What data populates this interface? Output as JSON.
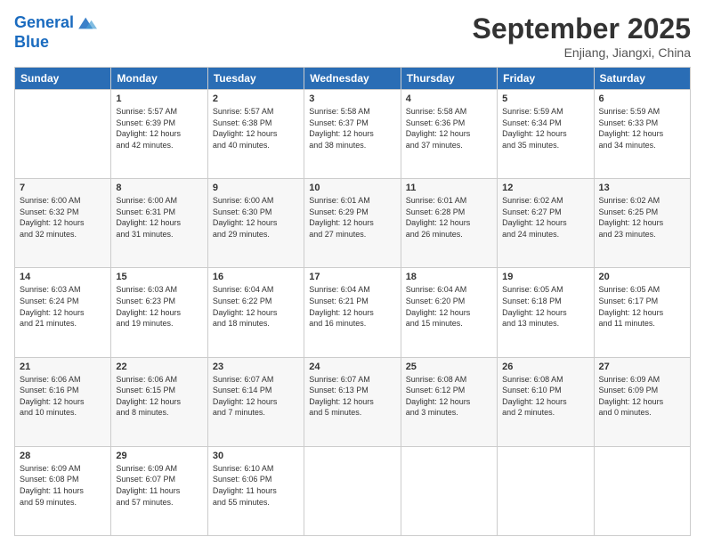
{
  "logo": {
    "line1": "General",
    "line2": "Blue"
  },
  "title": "September 2025",
  "location": "Enjiang, Jiangxi, China",
  "headers": [
    "Sunday",
    "Monday",
    "Tuesday",
    "Wednesday",
    "Thursday",
    "Friday",
    "Saturday"
  ],
  "weeks": [
    [
      {
        "day": "",
        "info": ""
      },
      {
        "day": "1",
        "info": "Sunrise: 5:57 AM\nSunset: 6:39 PM\nDaylight: 12 hours\nand 42 minutes."
      },
      {
        "day": "2",
        "info": "Sunrise: 5:57 AM\nSunset: 6:38 PM\nDaylight: 12 hours\nand 40 minutes."
      },
      {
        "day": "3",
        "info": "Sunrise: 5:58 AM\nSunset: 6:37 PM\nDaylight: 12 hours\nand 38 minutes."
      },
      {
        "day": "4",
        "info": "Sunrise: 5:58 AM\nSunset: 6:36 PM\nDaylight: 12 hours\nand 37 minutes."
      },
      {
        "day": "5",
        "info": "Sunrise: 5:59 AM\nSunset: 6:34 PM\nDaylight: 12 hours\nand 35 minutes."
      },
      {
        "day": "6",
        "info": "Sunrise: 5:59 AM\nSunset: 6:33 PM\nDaylight: 12 hours\nand 34 minutes."
      }
    ],
    [
      {
        "day": "7",
        "info": "Sunrise: 6:00 AM\nSunset: 6:32 PM\nDaylight: 12 hours\nand 32 minutes."
      },
      {
        "day": "8",
        "info": "Sunrise: 6:00 AM\nSunset: 6:31 PM\nDaylight: 12 hours\nand 31 minutes."
      },
      {
        "day": "9",
        "info": "Sunrise: 6:00 AM\nSunset: 6:30 PM\nDaylight: 12 hours\nand 29 minutes."
      },
      {
        "day": "10",
        "info": "Sunrise: 6:01 AM\nSunset: 6:29 PM\nDaylight: 12 hours\nand 27 minutes."
      },
      {
        "day": "11",
        "info": "Sunrise: 6:01 AM\nSunset: 6:28 PM\nDaylight: 12 hours\nand 26 minutes."
      },
      {
        "day": "12",
        "info": "Sunrise: 6:02 AM\nSunset: 6:27 PM\nDaylight: 12 hours\nand 24 minutes."
      },
      {
        "day": "13",
        "info": "Sunrise: 6:02 AM\nSunset: 6:25 PM\nDaylight: 12 hours\nand 23 minutes."
      }
    ],
    [
      {
        "day": "14",
        "info": "Sunrise: 6:03 AM\nSunset: 6:24 PM\nDaylight: 12 hours\nand 21 minutes."
      },
      {
        "day": "15",
        "info": "Sunrise: 6:03 AM\nSunset: 6:23 PM\nDaylight: 12 hours\nand 19 minutes."
      },
      {
        "day": "16",
        "info": "Sunrise: 6:04 AM\nSunset: 6:22 PM\nDaylight: 12 hours\nand 18 minutes."
      },
      {
        "day": "17",
        "info": "Sunrise: 6:04 AM\nSunset: 6:21 PM\nDaylight: 12 hours\nand 16 minutes."
      },
      {
        "day": "18",
        "info": "Sunrise: 6:04 AM\nSunset: 6:20 PM\nDaylight: 12 hours\nand 15 minutes."
      },
      {
        "day": "19",
        "info": "Sunrise: 6:05 AM\nSunset: 6:18 PM\nDaylight: 12 hours\nand 13 minutes."
      },
      {
        "day": "20",
        "info": "Sunrise: 6:05 AM\nSunset: 6:17 PM\nDaylight: 12 hours\nand 11 minutes."
      }
    ],
    [
      {
        "day": "21",
        "info": "Sunrise: 6:06 AM\nSunset: 6:16 PM\nDaylight: 12 hours\nand 10 minutes."
      },
      {
        "day": "22",
        "info": "Sunrise: 6:06 AM\nSunset: 6:15 PM\nDaylight: 12 hours\nand 8 minutes."
      },
      {
        "day": "23",
        "info": "Sunrise: 6:07 AM\nSunset: 6:14 PM\nDaylight: 12 hours\nand 7 minutes."
      },
      {
        "day": "24",
        "info": "Sunrise: 6:07 AM\nSunset: 6:13 PM\nDaylight: 12 hours\nand 5 minutes."
      },
      {
        "day": "25",
        "info": "Sunrise: 6:08 AM\nSunset: 6:12 PM\nDaylight: 12 hours\nand 3 minutes."
      },
      {
        "day": "26",
        "info": "Sunrise: 6:08 AM\nSunset: 6:10 PM\nDaylight: 12 hours\nand 2 minutes."
      },
      {
        "day": "27",
        "info": "Sunrise: 6:09 AM\nSunset: 6:09 PM\nDaylight: 12 hours\nand 0 minutes."
      }
    ],
    [
      {
        "day": "28",
        "info": "Sunrise: 6:09 AM\nSunset: 6:08 PM\nDaylight: 11 hours\nand 59 minutes."
      },
      {
        "day": "29",
        "info": "Sunrise: 6:09 AM\nSunset: 6:07 PM\nDaylight: 11 hours\nand 57 minutes."
      },
      {
        "day": "30",
        "info": "Sunrise: 6:10 AM\nSunset: 6:06 PM\nDaylight: 11 hours\nand 55 minutes."
      },
      {
        "day": "",
        "info": ""
      },
      {
        "day": "",
        "info": ""
      },
      {
        "day": "",
        "info": ""
      },
      {
        "day": "",
        "info": ""
      }
    ]
  ]
}
